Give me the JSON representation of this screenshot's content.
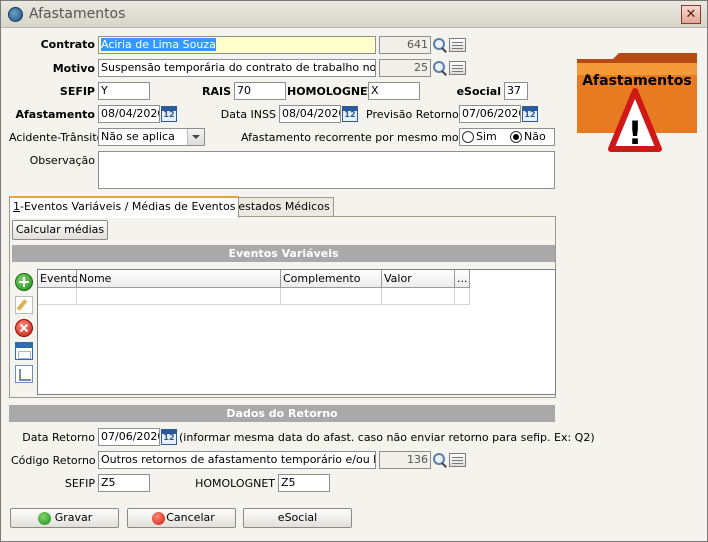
{
  "window": {
    "title": "Afastamentos",
    "close_glyph": "✕"
  },
  "form": {
    "contrato": {
      "label": "Contrato",
      "name": "Aciria de Lima Souza",
      "code": "641"
    },
    "motivo": {
      "label": "Motivo",
      "value": "Suspensão temporária do contrato de trabalho nos termo",
      "code": "25"
    },
    "sefip": {
      "label": "SEFIP",
      "value": "Y"
    },
    "rais": {
      "label": "RAIS",
      "value": "70"
    },
    "homolognet": {
      "label": "HOMOLOGNET",
      "value": "X"
    },
    "esocial": {
      "label": "eSocial",
      "value": "37"
    },
    "afastamento": {
      "label": "Afastamento",
      "value": "08/04/2020"
    },
    "data_inss": {
      "label": "Data INSS",
      "value": "08/04/2020"
    },
    "previsao_retorno": {
      "label": "Previsão Retorno",
      "value": "07/06/2020"
    },
    "acidente_transito": {
      "label": "Acidente-Trânsito",
      "value": "Não se aplica"
    },
    "recorrente": {
      "label": "Afastamento recorrente por mesmo motivo",
      "opt_sim": "Sim",
      "opt_nao": "Não",
      "selected": "Não"
    },
    "observacao": {
      "label": "Observação",
      "value": ""
    }
  },
  "calendar_glyph": "12",
  "logo": {
    "text": "Afastamentos",
    "warning_glyph": "!"
  },
  "tabs": [
    {
      "key": "1",
      "label": "-Eventos Variáveis / Médias de Eventos",
      "active": true
    },
    {
      "key": "2",
      "label": "-Atestados Médicos",
      "active": false
    }
  ],
  "eventos": {
    "calc_button": "Calcular médias",
    "section_title": "Eventos Variáveis",
    "columns": [
      "Evento",
      "Nome",
      "Complemento",
      "Valor",
      "..."
    ],
    "icons": [
      "add-icon",
      "edit-icon",
      "delete-icon",
      "window-icon",
      "window-edit-icon"
    ]
  },
  "retorno": {
    "section_title": "Dados do Retorno",
    "data_retorno": {
      "label": "Data Retorno",
      "value": "07/06/2020",
      "hint": "(informar mesma data do afast. caso não enviar retorno para sefip. Ex: Q2)"
    },
    "codigo_retorno": {
      "label": "Código Retorno",
      "value": "Outros retornos de afastamento temporário e/ou licença",
      "code": "136"
    },
    "sefip": {
      "label": "SEFIP",
      "value": "Z5"
    },
    "homolognet": {
      "label": "HOMOLOGNET",
      "value": "Z5"
    }
  },
  "buttons": {
    "gravar": "Gravar",
    "cancelar": "Cancelar",
    "esocial": "eSocial"
  }
}
